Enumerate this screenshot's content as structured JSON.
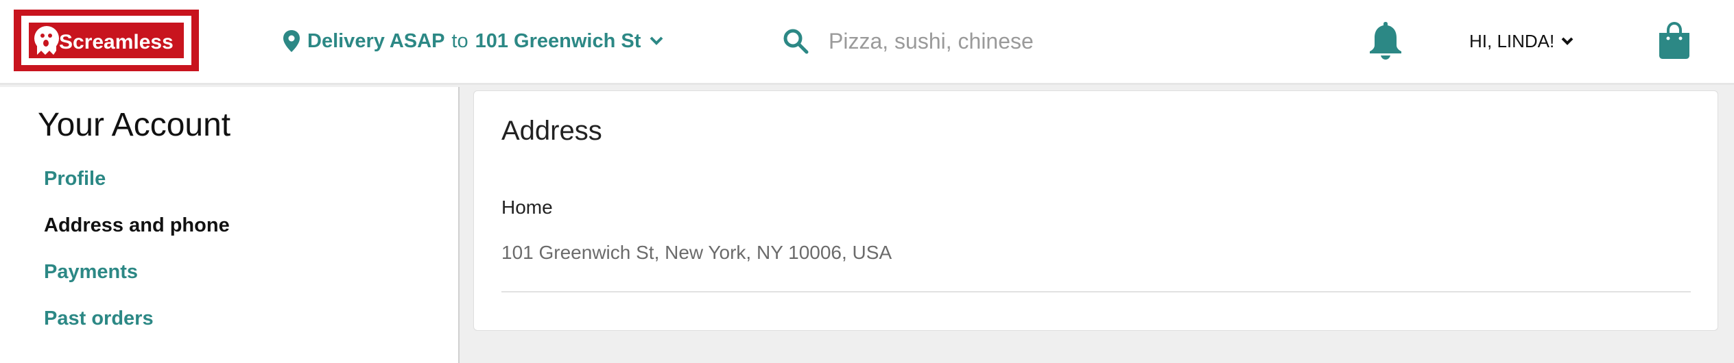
{
  "header": {
    "logo_text": "Screamless",
    "delivery": {
      "prefix": "Delivery ASAP",
      "connector": "to",
      "address": "101 Greenwich St"
    },
    "search": {
      "placeholder": "Pizza, sushi, chinese",
      "value": ""
    },
    "user_greeting": "HI, LINDA!"
  },
  "sidebar": {
    "title": "Your Account",
    "items": [
      {
        "label": "Profile",
        "active": false
      },
      {
        "label": "Address and phone",
        "active": true
      },
      {
        "label": "Payments",
        "active": false
      },
      {
        "label": "Past orders",
        "active": false
      }
    ]
  },
  "main": {
    "section_title": "Address",
    "address": {
      "label": "Home",
      "value": "101 Greenwich St, New York, NY 10006, USA"
    }
  },
  "colors": {
    "accent": "#2c8885",
    "brand_red": "#c8141e",
    "page_background": "#efefef"
  },
  "icons": {
    "logo": "screamless-logo",
    "location": "map-pin-icon",
    "search": "search-icon",
    "notifications": "bell-icon",
    "cart": "shopping-bag-icon",
    "dropdown": "chevron-down-icon"
  }
}
